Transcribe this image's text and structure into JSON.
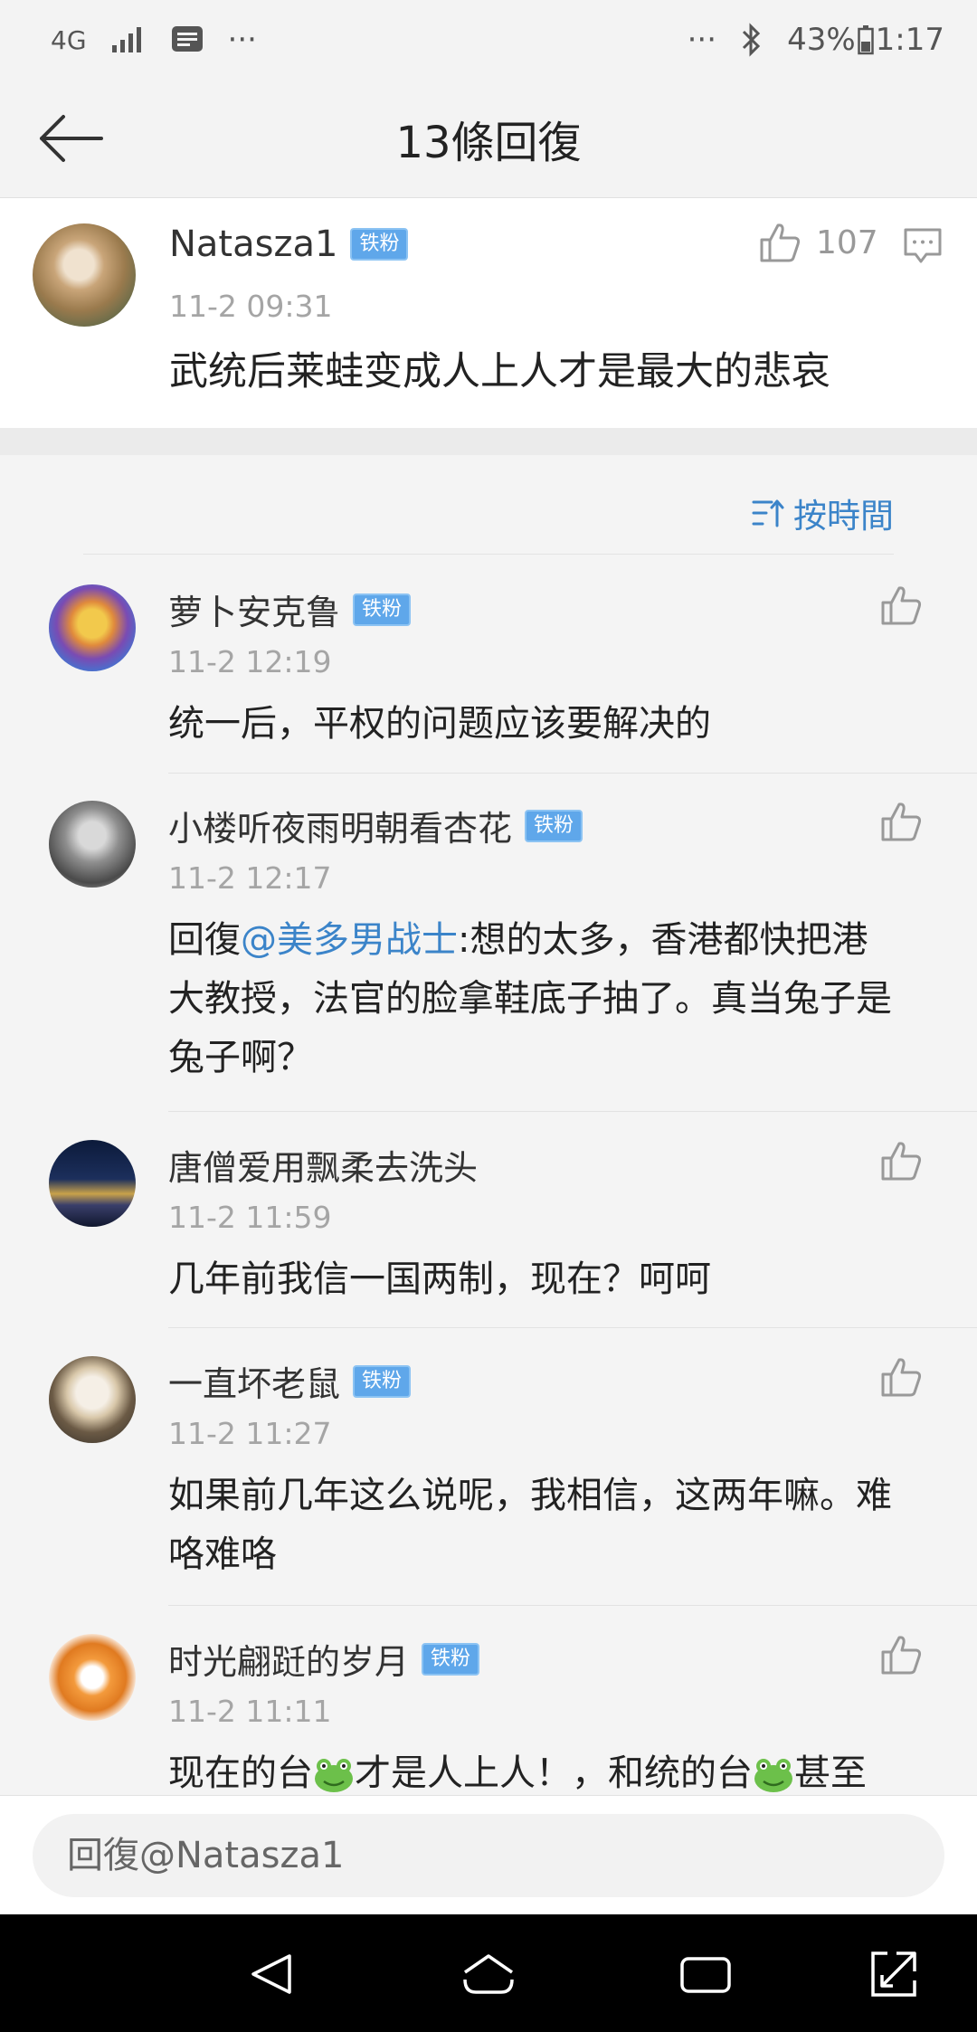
{
  "status_bar": {
    "network": "4G",
    "more_left": "···",
    "more_right": "···",
    "battery": "43%",
    "time": "1:17"
  },
  "header": {
    "title": "13條回復"
  },
  "original_post": {
    "username": "Natasza1",
    "badge": "铁粉",
    "timestamp": "11-2 09:31",
    "likes": "107",
    "content": "武统后莱蛙变成人上人才是最大的悲哀"
  },
  "sort": {
    "label": "按時間"
  },
  "comments": [
    {
      "username": "萝卜安克鲁",
      "badge": "铁粉",
      "timestamp": "11-2 12:19",
      "content": "统一后，平权的问题应该要解决的"
    },
    {
      "username": "小楼听夜雨明朝看杏花",
      "badge": "铁粉",
      "timestamp": "11-2 12:17",
      "content_prefix": "回復",
      "mention": "@美多男战士",
      "content_line1": ":想的太多，香港都快把港",
      "content_line2": "大教授，法官的脸拿鞋底子抽了。真当兔子是",
      "content_line3": "兔子啊？"
    },
    {
      "username": "唐僧爱用飘柔去洗头",
      "timestamp": "11-2 11:59",
      "content": "几年前我信一国两制，现在？呵呵"
    },
    {
      "username": "一直坏老鼠",
      "badge": "铁粉",
      "timestamp": "11-2 11:27",
      "content_line1": "如果前几年这么说呢，我相信，这两年嘛。难",
      "content_line2": "咯难咯"
    },
    {
      "username": "时光翩跹的岁月",
      "badge": "铁粉",
      "timestamp": "11-2 11:11",
      "content_part1": "现在的台",
      "content_part2": "才是人上人！，和统的台",
      "content_part3": "甚至"
    }
  ],
  "reply_bar": {
    "placeholder": "回復@Natasza1"
  },
  "icons": {
    "back": "arrow-left-icon",
    "like": "thumbs-up-icon",
    "reply": "comment-icon",
    "sort": "sort-icon",
    "frog": "frog-emoji-icon"
  },
  "colors": {
    "accent": "#3b84c9",
    "badge": "#5fa7ea"
  }
}
